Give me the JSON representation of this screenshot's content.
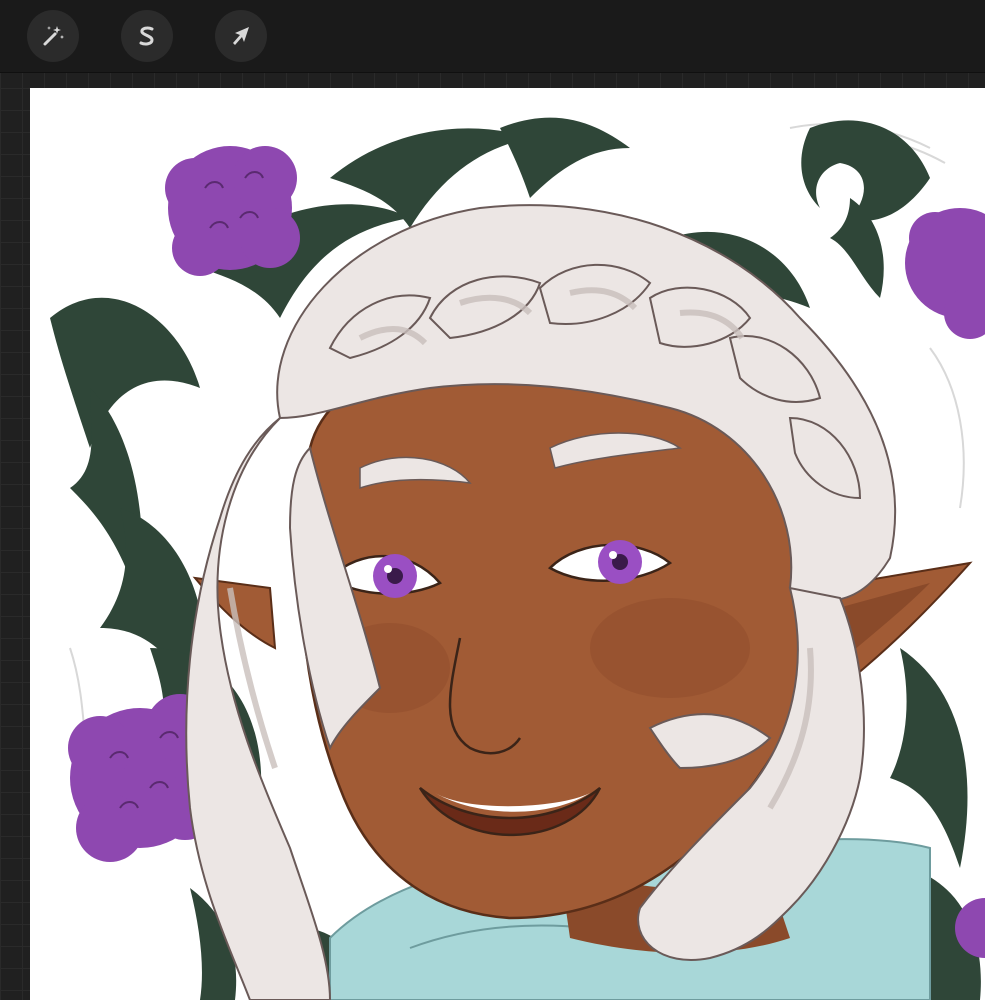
{
  "toolbar": {
    "tools": [
      {
        "name": "adjustments",
        "icon": "magic-wand-icon"
      },
      {
        "name": "selection",
        "icon": "selection-s-icon"
      },
      {
        "name": "transform",
        "icon": "arrow-cursor-icon"
      }
    ]
  },
  "canvas": {
    "background": "#ffffff",
    "artwork": "illustration"
  },
  "colors": {
    "toolbar_bg": "#1a1a1a",
    "button_bg": "#2b2b2b",
    "icon": "#d9d9d9",
    "workspace_bg": "#202020",
    "skin": "#a15b35",
    "hair": "#ece6e4",
    "leaves": "#2f4638",
    "flowers": "#8e48b0",
    "eyes": "#9a4fc3",
    "collar": "#a8d7d8"
  }
}
